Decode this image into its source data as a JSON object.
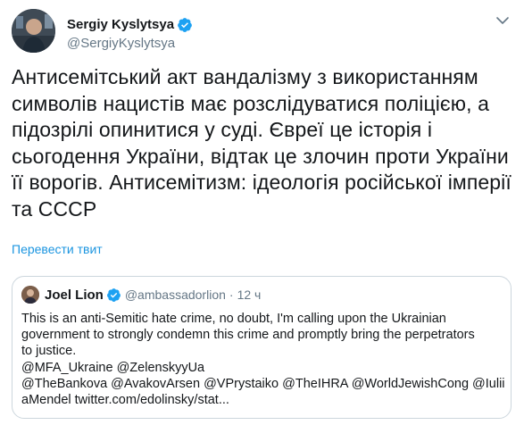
{
  "author": {
    "name": "Sergiy Kyslytsya",
    "handle": "@SergiyKyslytsya",
    "verified": true
  },
  "tweet": {
    "lines": [
      "Антисемітський акт вандалізму з використанням",
      "символів нацистів має розслідуватися поліцією, а",
      "підозрілі опинитися у суді. Євреї це історія і",
      "сьогодення України, відтак це злочин проти України",
      "її ворогів. Антисемітизм: ідеологія російської імперії",
      "та СССР"
    ],
    "translate_label": "Перевести твит"
  },
  "quoted": {
    "name": "Joel Lion",
    "handle": "@ambassadorlion",
    "separator": "·",
    "time": "12 ч",
    "verified": true,
    "lines": [
      "This is an anti-Semitic hate crime, no doubt, I'm calling upon the Ukrainian",
      "government to strongly condemn this crime and promptly bring the perpetrators",
      "to justice.",
      "@MFA_Ukraine @ZelenskyyUa",
      "@TheBankova @AvakovArsen @VPrystaiko @TheIHRA @WorldJewishCong @Iulii",
      "aMendel twitter.com/edolinsky/stat..."
    ]
  },
  "colors": {
    "accent": "#1b95e0",
    "verified": "#1da1f2",
    "muted": "#657786",
    "border": "#ccd6dd"
  },
  "icons": {
    "verified": "verified-badge-icon",
    "caret": "chevron-down-icon"
  }
}
